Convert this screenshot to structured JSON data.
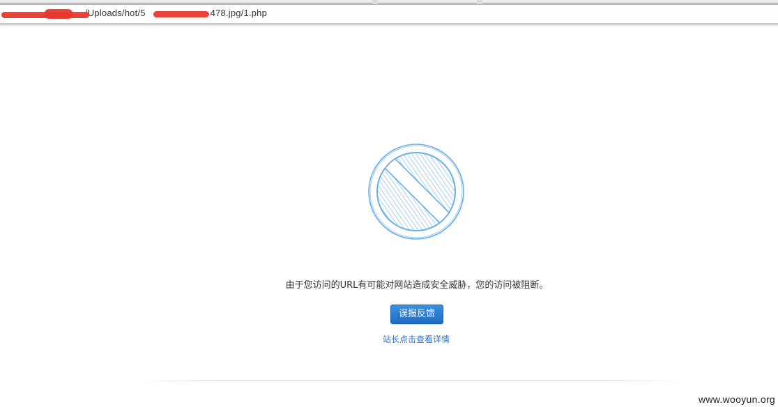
{
  "browser": {
    "url_visible_fragments": {
      "prefix": "/Uploads/hot/5",
      "suffix": "478.jpg/1.php"
    }
  },
  "main": {
    "icon": "blocked-icon",
    "message": "由于您访问的URL有可能对网站造成安全威胁，您的访问被阻断。",
    "report_button_label": "误报反馈",
    "admin_link_label": "站长点击查看详情"
  },
  "watermark": "www.wooyun.org",
  "colors": {
    "accent": "#2a6fc9",
    "icon_stroke": "#6aaee8",
    "button_top": "#3d8fe0",
    "button_bottom": "#1c6cc6"
  }
}
